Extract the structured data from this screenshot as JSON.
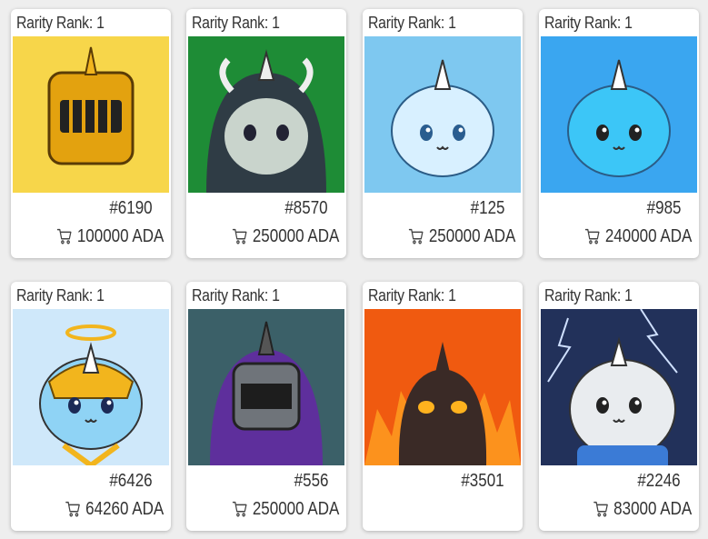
{
  "currency": "ADA",
  "cards": [
    {
      "rank_label": "Rarity Rank: 1",
      "number": "#6190",
      "price": "100000 ADA",
      "bg": "#f7d64a",
      "body": "#f2b51d",
      "eye": "#222",
      "art": "gold-knight"
    },
    {
      "rank_label": "Rarity Rank: 1",
      "number": "#8570",
      "price": "250000 ADA",
      "bg": "#1e8c36",
      "body": "#c9d4cc",
      "eye": "#2b2b2b",
      "art": "dark-hood"
    },
    {
      "rank_label": "Rarity Rank: 1",
      "number": "#125",
      "price": "250000 ADA",
      "bg": "#7ec8f0",
      "body": "#d8f0ff",
      "eye": "#2a5d8f",
      "art": "ice"
    },
    {
      "rank_label": "Rarity Rank: 1",
      "number": "#985",
      "price": "240000 ADA",
      "bg": "#3aa6f0",
      "body": "#3cc6f7",
      "eye": "#222",
      "art": "blue"
    },
    {
      "rank_label": "Rarity Rank: 1",
      "number": "#6426",
      "price": "64260 ADA",
      "bg": "#cfe8fa",
      "body": "#8fd3f5",
      "eye": "#1c2a56",
      "art": "angel"
    },
    {
      "rank_label": "Rarity Rank: 1",
      "number": "#556",
      "price": "250000 ADA",
      "bg": "#3b6068",
      "body": "#5e2f9c",
      "eye": "#222",
      "art": "purple-knight"
    },
    {
      "rank_label": "Rarity Rank: 1",
      "number": "#3501",
      "price": "",
      "bg": "#f05a10",
      "body": "#3a2a26",
      "eye": "#ffb21e",
      "art": "fire"
    },
    {
      "rank_label": "Rarity Rank: 1",
      "number": "#2246",
      "price": "83000 ADA",
      "bg": "#22315a",
      "body": "#e9ecef",
      "eye": "#222",
      "art": "storm"
    }
  ]
}
